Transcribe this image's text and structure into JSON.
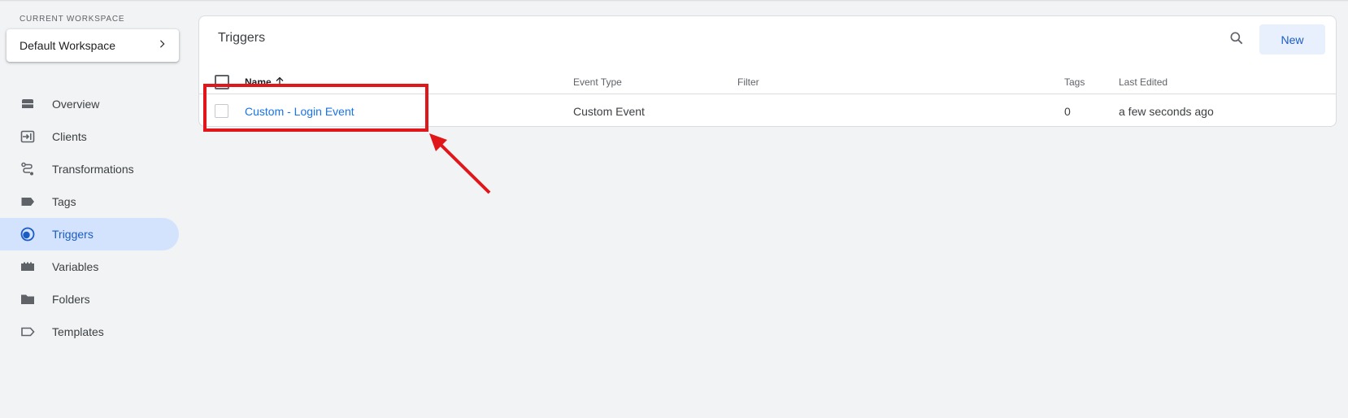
{
  "sidebar": {
    "workspace_label": "CURRENT WORKSPACE",
    "workspace_name": "Default Workspace",
    "items": [
      {
        "label": "Overview",
        "icon": "overview-icon"
      },
      {
        "label": "Clients",
        "icon": "clients-icon"
      },
      {
        "label": "Transformations",
        "icon": "transformations-icon"
      },
      {
        "label": "Tags",
        "icon": "tag-icon"
      },
      {
        "label": "Triggers",
        "icon": "triggers-icon",
        "active": true
      },
      {
        "label": "Variables",
        "icon": "variables-icon"
      },
      {
        "label": "Folders",
        "icon": "folder-icon"
      },
      {
        "label": "Templates",
        "icon": "templates-icon"
      }
    ]
  },
  "main": {
    "title": "Triggers",
    "new_label": "New",
    "columns": {
      "name": "Name",
      "event_type": "Event Type",
      "filter": "Filter",
      "tags": "Tags",
      "last_edited": "Last Edited"
    },
    "rows": [
      {
        "name": "Custom - Login Event",
        "event_type": "Custom Event",
        "filter": "",
        "tags": "0",
        "last_edited": "a few seconds ago"
      }
    ]
  },
  "colors": {
    "accent": "#1a73e8",
    "active_nav_bg": "#d3e3fd",
    "annotation": "#e0161b",
    "background": "#f1f3f4"
  }
}
